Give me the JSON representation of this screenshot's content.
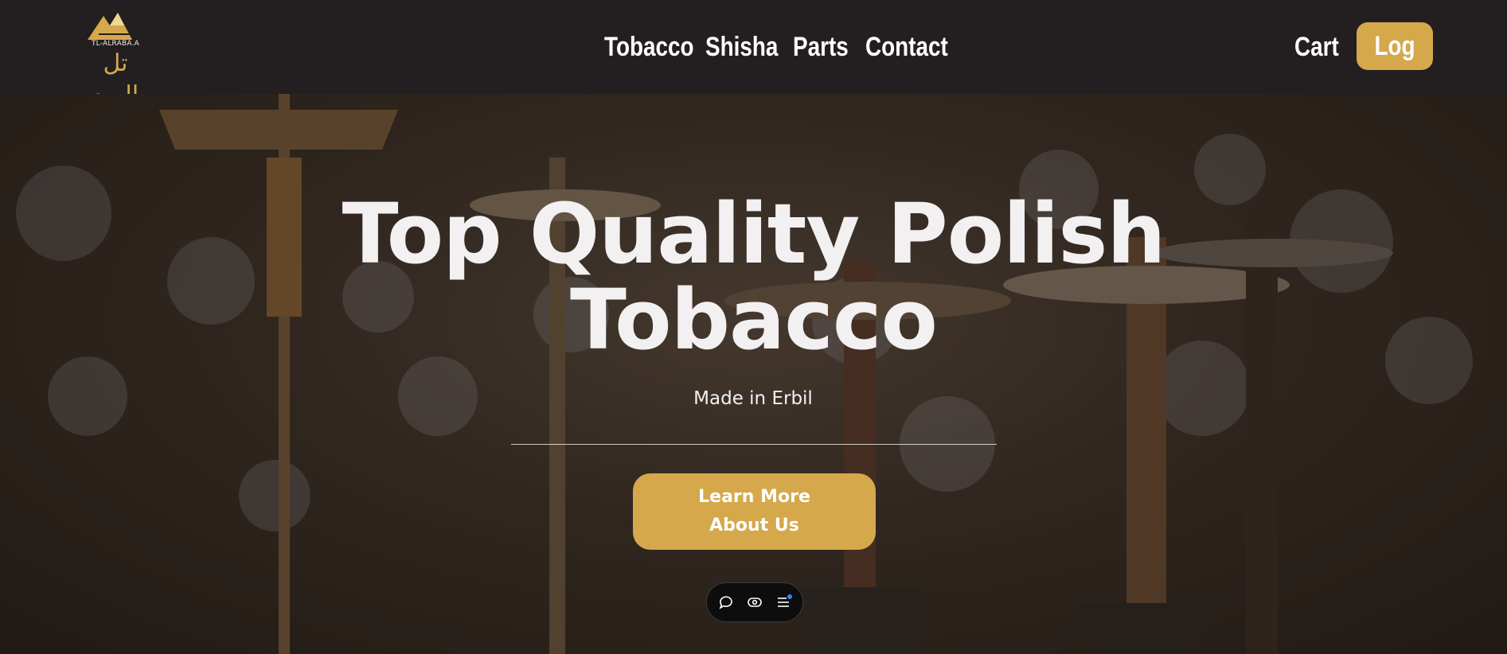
{
  "brand": {
    "latin_name": "TL-ALRABA.A",
    "arabic_name": "تل الربع",
    "color": "#d5a84c"
  },
  "nav": {
    "links": [
      "Tobacco",
      "Shisha",
      "Parts",
      "Contact"
    ],
    "cart_label": "Cart",
    "login_label": "Log in"
  },
  "hero": {
    "headline_line1": "Top Quality Polish",
    "headline_line2": "Tobacco",
    "subtitle": "Made in Erbil",
    "cta_line1": "Learn More",
    "cta_line2": "About Us"
  },
  "toolbar": {
    "icons": [
      "comment-icon",
      "view-icon",
      "menu-icon"
    ]
  }
}
